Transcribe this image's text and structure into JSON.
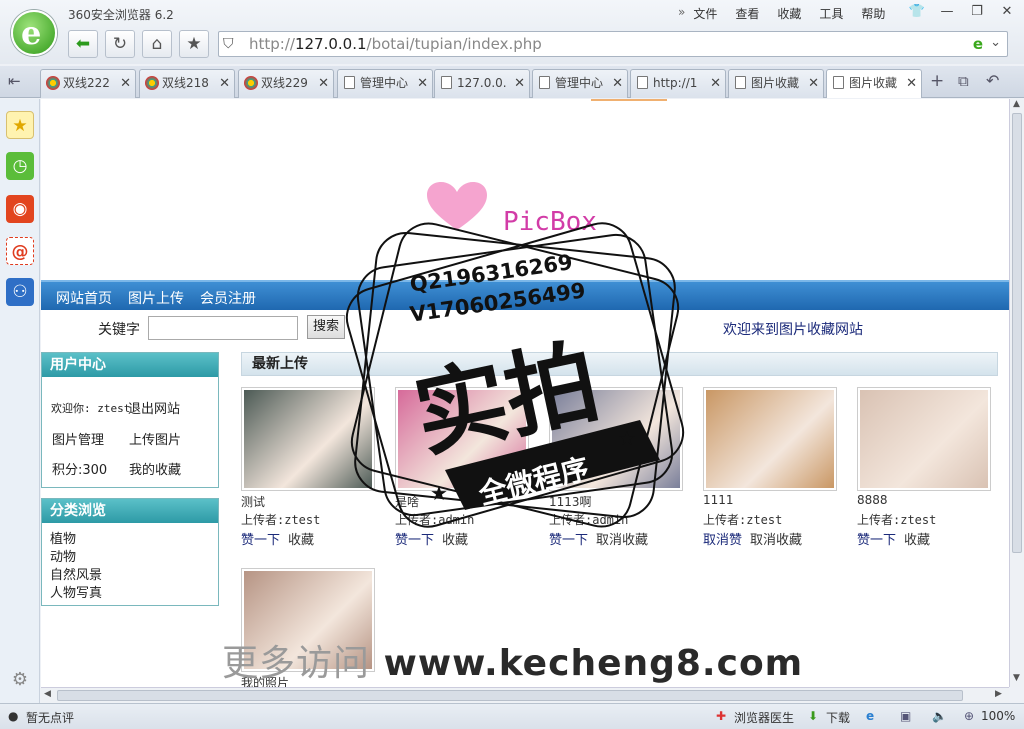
{
  "browser": {
    "title": "360安全浏览器 6.2",
    "menu": [
      "文件",
      "查看",
      "收藏",
      "工具",
      "帮助"
    ],
    "url_prefix": "http://",
    "url_host": "127.0.0.1",
    "url_path": "/botai/tupian/index.php"
  },
  "tabs": [
    {
      "label": "双线222"
    },
    {
      "label": "双线218"
    },
    {
      "label": "双线229"
    },
    {
      "label": "管理中心"
    },
    {
      "label": "127.0.0."
    },
    {
      "label": "管理中心"
    },
    {
      "label": "http://1"
    },
    {
      "label": "图片收藏"
    },
    {
      "label": "图片收藏"
    }
  ],
  "site": {
    "logo_text": "PicBox",
    "nav": [
      "网站首页",
      "图片上传",
      "会员注册"
    ],
    "search_label": "关键字",
    "search_button": "搜索",
    "welcome": "欢迎来到图片收藏网站"
  },
  "user_center": {
    "title": "用户中心",
    "greeting": "欢迎你: ztest",
    "logout": "退出网站",
    "manage": "图片管理",
    "upload": "上传图片",
    "points": "积分:300",
    "favorites": "我的收藏"
  },
  "categories": {
    "title": "分类浏览",
    "items": [
      "植物",
      "动物",
      "自然风景",
      "人物写真"
    ]
  },
  "latest": {
    "title": "最新上传",
    "cards": [
      {
        "name": "测试",
        "uploader": "上传者:ztest",
        "like": "赞一下",
        "fav": "收藏",
        "color": "#4c5a55"
      },
      {
        "name": "是啥",
        "uploader": "上传者:admin",
        "like": "赞一下",
        "fav": "收藏",
        "color": "#d66a9a"
      },
      {
        "name": "1113啊",
        "uploader": "上传者:admin",
        "like": "赞一下",
        "fav": "取消收藏",
        "color": "#7a7f9a"
      },
      {
        "name": "1111",
        "uploader": "上传者:ztest",
        "like": "取消赞",
        "fav": "取消收藏",
        "color": "#c99764"
      },
      {
        "name": "8888",
        "uploader": "上传者:ztest",
        "like": "赞一下",
        "fav": "收藏",
        "color": "#d9c2b3"
      },
      {
        "name": "我的照片",
        "uploader": "",
        "like": "",
        "fav": "",
        "color": "#b69484"
      }
    ]
  },
  "watermark": {
    "qq": "Q2196316269",
    "wx": "V17060256499",
    "big": "实拍",
    "band": "全微程序",
    "footer_faint": "更多访问",
    "footer": "www.kecheng8.com"
  },
  "status": {
    "left": "暂无点评",
    "doctor": "浏览器医生",
    "download": "下载",
    "zoom": "100%"
  }
}
